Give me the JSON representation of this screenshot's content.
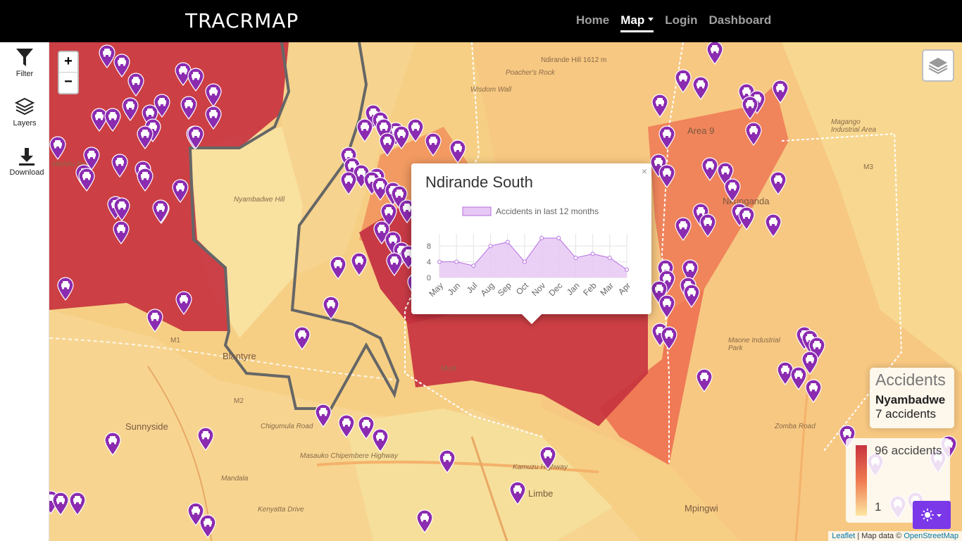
{
  "navbar": {
    "brand": "TRACRMAP",
    "links": [
      {
        "label": "Home"
      },
      {
        "label": "Map"
      },
      {
        "label": "Login"
      },
      {
        "label": "Dashboard"
      }
    ]
  },
  "sidebar": {
    "filter": "Filter",
    "layers": "Layers",
    "download": "Download"
  },
  "map": {
    "zoom_in": "+",
    "zoom_out": "−",
    "labels": [
      "Ndirande Hill 1612 m",
      "Poacher's Rock",
      "Wisdom Wall",
      "Nyambadwe Hill",
      "Blantyre",
      "Limbe",
      "Sunnyside",
      "Mandala",
      "Mpingwi",
      "Maone Industrial Park",
      "Magango Industrial Area",
      "Area 9",
      "Nkunganda",
      "Mudi",
      "Kenyatta Drive",
      "Kamuzu Highway",
      "Masauko Chipembere Highway",
      "Zomba Road",
      "Michiru Road",
      "M1",
      "M2",
      "M3",
      "Chigumula Road"
    ]
  },
  "popup": {
    "title": "Ndirande South",
    "close": "×"
  },
  "chart_data": {
    "type": "area",
    "series": [
      {
        "name": "Accidents in last 12 months",
        "values": [
          4,
          4,
          3,
          8,
          9,
          4,
          10,
          10,
          5,
          6,
          5,
          2
        ]
      }
    ],
    "categories": [
      "May",
      "Jun",
      "Jul",
      "Aug",
      "Sep",
      "Oct",
      "Nov",
      "Dec",
      "Jan",
      "Feb",
      "Mar",
      "Apr"
    ],
    "yticks": [
      0,
      4,
      8
    ],
    "ylim": [
      0,
      10
    ],
    "legend": "top",
    "grid": true,
    "colors": {
      "fill": "#e8c8f4",
      "line": "#b46ee0"
    }
  },
  "info": {
    "heading": "Accidents",
    "area": "Nyambadwe",
    "count": "7 accidents"
  },
  "legend": {
    "max": "96 accidents",
    "min": "1"
  },
  "attribution": {
    "leaflet": "Leaflet",
    "sep": " | Map data © ",
    "osm": "OpenStreetMap"
  },
  "colors": {
    "marker": "#8b2bb0",
    "high": "#c8333f",
    "mid": "#ef7a50",
    "low": "#fde6a2",
    "theme_button": "#7a38e8"
  }
}
